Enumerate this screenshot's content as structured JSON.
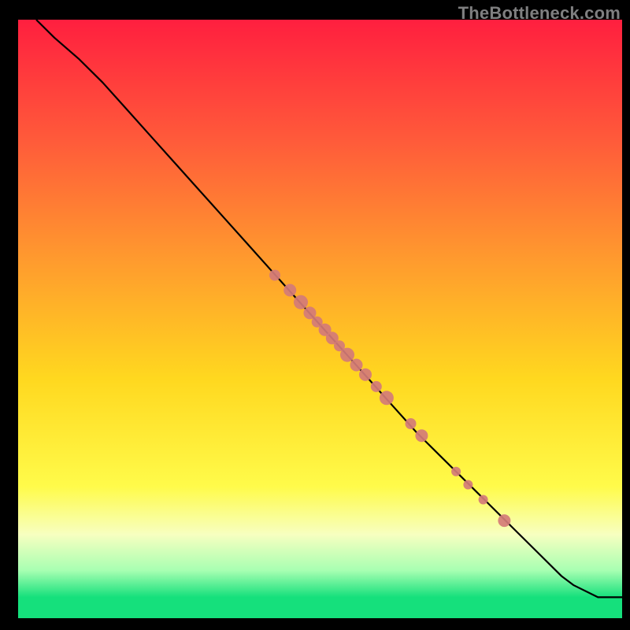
{
  "watermark": "TheBottleneck.com",
  "chart_data": {
    "type": "line",
    "title": "",
    "xlabel": "",
    "ylabel": "",
    "xlim": [
      0,
      100
    ],
    "ylim": [
      0,
      100
    ],
    "background_gradient_stops": [
      {
        "pos": 0.0,
        "color": "#ff1f3f"
      },
      {
        "pos": 0.2,
        "color": "#ff5a3a"
      },
      {
        "pos": 0.4,
        "color": "#ff9a2e"
      },
      {
        "pos": 0.6,
        "color": "#ffd81f"
      },
      {
        "pos": 0.78,
        "color": "#fffb4a"
      },
      {
        "pos": 0.86,
        "color": "#f7ffc0"
      },
      {
        "pos": 0.92,
        "color": "#a8ffb2"
      },
      {
        "pos": 0.965,
        "color": "#15e07c"
      },
      {
        "pos": 1.0,
        "color": "#15e07c"
      }
    ],
    "series": [
      {
        "name": "curve",
        "x": [
          3,
          6,
          10,
          14,
          18,
          22,
          26,
          30,
          34,
          38,
          42,
          46,
          50,
          54,
          58,
          62,
          66,
          70,
          74,
          78,
          82,
          86,
          90,
          92,
          96,
          100
        ],
        "y": [
          100,
          97,
          93.5,
          89.5,
          85,
          80.5,
          76,
          71.5,
          67,
          62.5,
          58,
          53.5,
          49,
          44.5,
          40,
          35.5,
          31,
          27,
          23,
          19,
          15,
          11,
          7,
          5.5,
          3.5,
          3.5
        ]
      }
    ],
    "points": {
      "name": "markers",
      "color": "#d47b78",
      "items": [
        {
          "x": 42.5,
          "y": 57.3,
          "r": 7
        },
        {
          "x": 45.0,
          "y": 54.8,
          "r": 8
        },
        {
          "x": 46.8,
          "y": 52.8,
          "r": 9
        },
        {
          "x": 48.3,
          "y": 51.0,
          "r": 8
        },
        {
          "x": 49.5,
          "y": 49.5,
          "r": 7
        },
        {
          "x": 50.8,
          "y": 48.2,
          "r": 8
        },
        {
          "x": 52.0,
          "y": 46.8,
          "r": 8
        },
        {
          "x": 53.2,
          "y": 45.5,
          "r": 7
        },
        {
          "x": 54.5,
          "y": 44.0,
          "r": 9
        },
        {
          "x": 56.0,
          "y": 42.3,
          "r": 8
        },
        {
          "x": 57.5,
          "y": 40.7,
          "r": 8
        },
        {
          "x": 59.3,
          "y": 38.7,
          "r": 7
        },
        {
          "x": 61.0,
          "y": 36.8,
          "r": 9
        },
        {
          "x": 65.0,
          "y": 32.5,
          "r": 7
        },
        {
          "x": 66.8,
          "y": 30.5,
          "r": 8
        },
        {
          "x": 72.5,
          "y": 24.5,
          "r": 6
        },
        {
          "x": 74.5,
          "y": 22.3,
          "r": 6
        },
        {
          "x": 77.0,
          "y": 19.8,
          "r": 6
        },
        {
          "x": 80.5,
          "y": 16.3,
          "r": 8
        }
      ]
    }
  }
}
